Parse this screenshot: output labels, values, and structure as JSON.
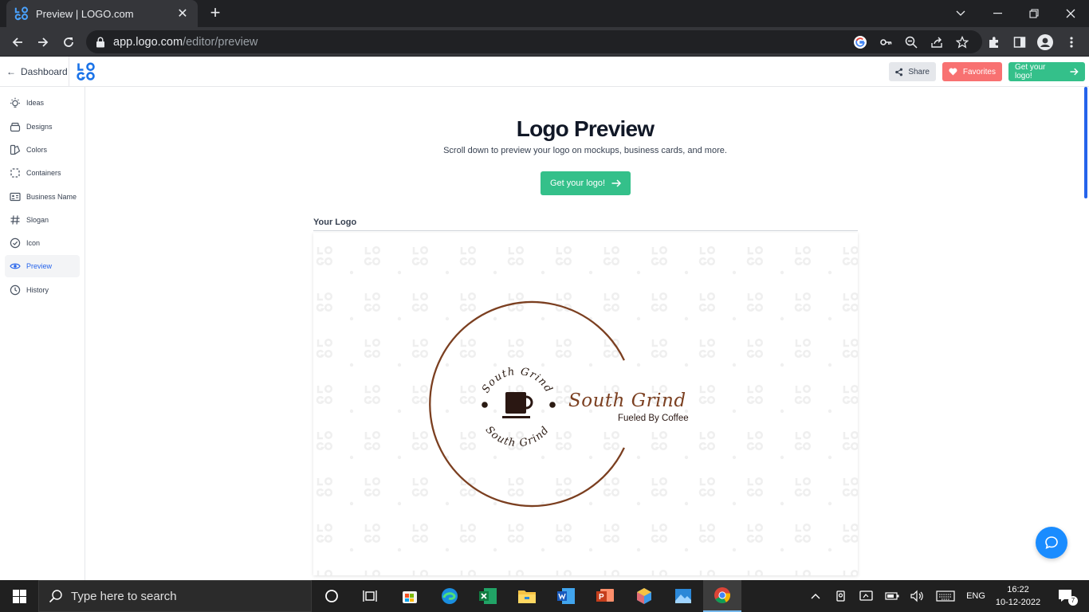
{
  "browser": {
    "tab_title": "Preview | LOGO.com",
    "url_host": "app.logo.com",
    "url_path": "/editor/preview"
  },
  "header": {
    "dashboard_label": "Dashboard",
    "share_label": "Share",
    "favorites_label": "Favorites",
    "get_logo_label": "Get your logo!"
  },
  "sidebar": {
    "items": [
      {
        "label": "Ideas",
        "icon": "lightbulb-icon"
      },
      {
        "label": "Designs",
        "icon": "layers-icon"
      },
      {
        "label": "Colors",
        "icon": "palette-icon"
      },
      {
        "label": "Containers",
        "icon": "dashed-square-icon"
      },
      {
        "label": "Business Name",
        "icon": "id-card-icon"
      },
      {
        "label": "Slogan",
        "icon": "hash-icon"
      },
      {
        "label": "Icon",
        "icon": "check-circle-icon"
      },
      {
        "label": "Preview",
        "icon": "eye-icon",
        "active": true
      },
      {
        "label": "History",
        "icon": "clock-icon"
      }
    ]
  },
  "main": {
    "title": "Logo Preview",
    "subtitle": "Scroll down to preview your logo on mockups, business cards, and more.",
    "cta_label": "Get your logo!",
    "section_title": "Your Logo"
  },
  "logo": {
    "business_name": "South Grind",
    "slogan": "Fueled By Coffee",
    "badge_text": "South Grind",
    "brand_color": "#7b3f20",
    "icon": "coffee-cup-icon"
  },
  "taskbar": {
    "search_placeholder": "Type here to search",
    "language": "ENG",
    "time": "16:22",
    "date": "10-12-2022",
    "notifications": "7"
  },
  "colors": {
    "accent_green": "#34c08a",
    "favorites_red": "#f87171",
    "brand_blue": "#1a73e8"
  }
}
